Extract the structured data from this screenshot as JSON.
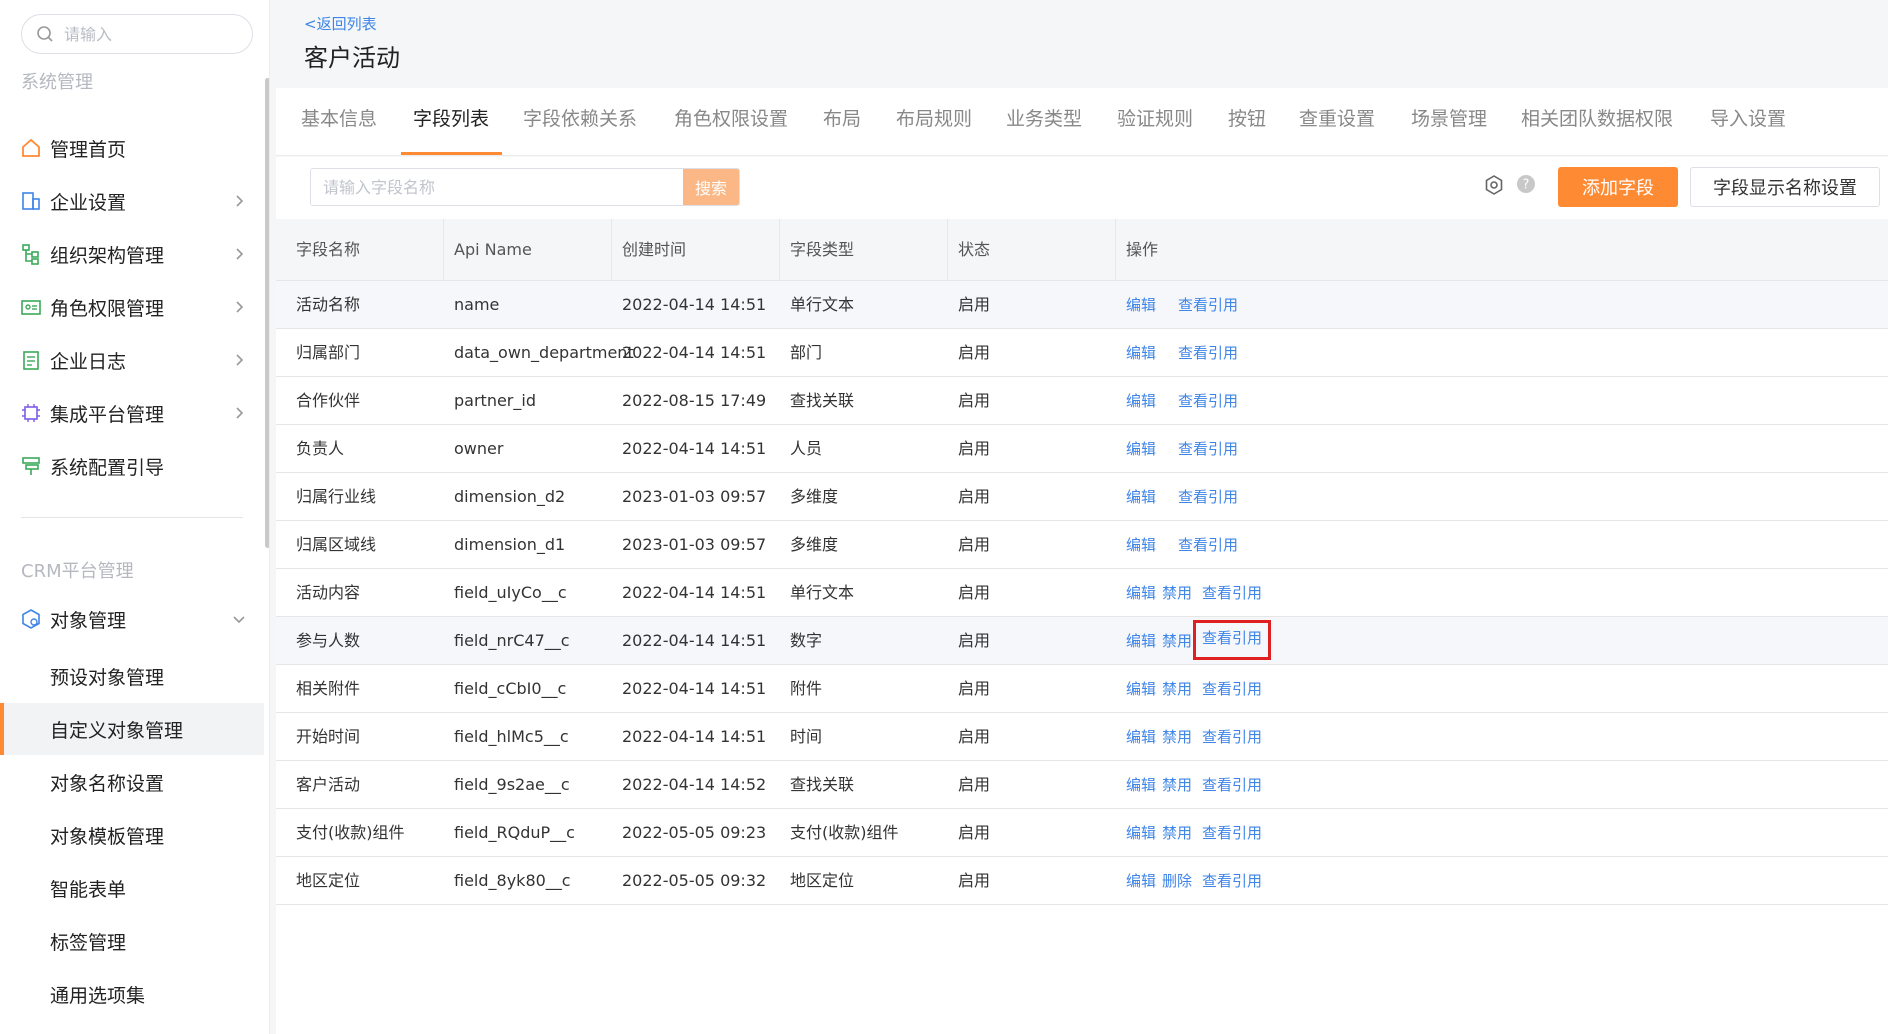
{
  "sidebar": {
    "search_placeholder": "请输入",
    "section_system": "系统管理",
    "system_items": [
      {
        "label": "管理首页",
        "icon": "home-icon"
      },
      {
        "label": "企业设置",
        "icon": "enterprise-icon"
      },
      {
        "label": "组织架构管理",
        "icon": "org-tree-icon"
      },
      {
        "label": "角色权限管理",
        "icon": "role-card-icon"
      },
      {
        "label": "企业日志",
        "icon": "log-icon"
      },
      {
        "label": "集成平台管理",
        "icon": "chip-icon"
      },
      {
        "label": "系统配置引导",
        "icon": "guide-icon"
      }
    ],
    "section_crm": "CRM平台管理",
    "object_mgmt": {
      "label": "对象管理",
      "icon": "object-icon"
    },
    "sub_items": [
      "预设对象管理",
      "自定义对象管理",
      "对象名称设置",
      "对象模板管理",
      "智能表单",
      "标签管理",
      "通用选项集"
    ]
  },
  "header": {
    "back": "<返回列表",
    "title": "客户活动"
  },
  "tabs": [
    "基本信息",
    "字段列表",
    "字段依赖关系",
    "角色权限设置",
    "布局",
    "布局规则",
    "业务类型",
    "验证规则",
    "按钮",
    "查重设置",
    "场景管理",
    "相关团队数据权限",
    "导入设置"
  ],
  "toolbar": {
    "search_placeholder": "请输入字段名称",
    "search_button": "搜索",
    "add_field": "添加字段",
    "display_name_settings": "字段显示名称设置"
  },
  "table": {
    "headers": [
      "字段名称",
      "Api Name",
      "创建时间",
      "字段类型",
      "状态",
      "操作"
    ],
    "rows": [
      {
        "name": "活动名称",
        "api": "name",
        "created": "2022-04-14 14:51",
        "type": "单行文本",
        "status": "启用",
        "actions": [
          "编辑",
          "查看引用"
        ]
      },
      {
        "name": "归属部门",
        "api": "data_own_department",
        "created": "2022-04-14 14:51",
        "type": "部门",
        "status": "启用",
        "actions": [
          "编辑",
          "查看引用"
        ]
      },
      {
        "name": "合作伙伴",
        "api": "partner_id",
        "created": "2022-08-15 17:49",
        "type": "查找关联",
        "status": "启用",
        "actions": [
          "编辑",
          "查看引用"
        ]
      },
      {
        "name": "负责人",
        "api": "owner",
        "created": "2022-04-14 14:51",
        "type": "人员",
        "status": "启用",
        "actions": [
          "编辑",
          "查看引用"
        ]
      },
      {
        "name": "归属行业线",
        "api": "dimension_d2",
        "created": "2023-01-03 09:57",
        "type": "多维度",
        "status": "启用",
        "actions": [
          "编辑",
          "查看引用"
        ]
      },
      {
        "name": "归属区域线",
        "api": "dimension_d1",
        "created": "2023-01-03 09:57",
        "type": "多维度",
        "status": "启用",
        "actions": [
          "编辑",
          "查看引用"
        ]
      },
      {
        "name": "活动内容",
        "api": "field_uIyCo__c",
        "created": "2022-04-14 14:51",
        "type": "单行文本",
        "status": "启用",
        "actions": [
          "编辑",
          "禁用",
          "查看引用"
        ]
      },
      {
        "name": "参与人数",
        "api": "field_nrC47__c",
        "created": "2022-04-14 14:51",
        "type": "数字",
        "status": "启用",
        "actions": [
          "编辑",
          "禁用",
          "查看引用"
        ]
      },
      {
        "name": "相关附件",
        "api": "field_cCbI0__c",
        "created": "2022-04-14 14:51",
        "type": "附件",
        "status": "启用",
        "actions": [
          "编辑",
          "禁用",
          "查看引用"
        ]
      },
      {
        "name": "开始时间",
        "api": "field_hlMc5__c",
        "created": "2022-04-14 14:51",
        "type": "时间",
        "status": "启用",
        "actions": [
          "编辑",
          "禁用",
          "查看引用"
        ]
      },
      {
        "name": "客户活动",
        "api": "field_9s2ae__c",
        "created": "2022-04-14 14:52",
        "type": "查找关联",
        "status": "启用",
        "actions": [
          "编辑",
          "禁用",
          "查看引用"
        ]
      },
      {
        "name": "支付(收款)组件",
        "api": "field_RQduP__c",
        "created": "2022-05-05 09:23",
        "type": "支付(收款)组件",
        "status": "启用",
        "actions": [
          "编辑",
          "禁用",
          "查看引用"
        ]
      },
      {
        "name": "地区定位",
        "api": "field_8yk80__c",
        "created": "2022-05-05 09:32",
        "type": "地区定位",
        "status": "启用",
        "actions": [
          "编辑",
          "删除",
          "查看引用"
        ]
      }
    ]
  },
  "colors": {
    "accent": "#ff8a34",
    "link": "#3e85e8",
    "highlight_box": "#e02020"
  }
}
